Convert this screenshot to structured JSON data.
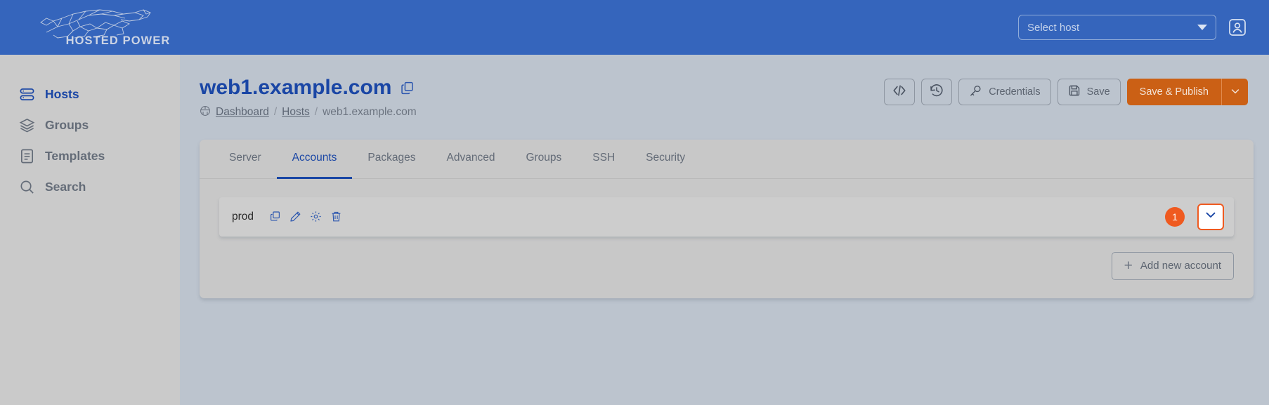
{
  "brand": {
    "wordmark": "HOSTED POWER",
    "logo_icon": "cheetah-wireframe-logo"
  },
  "topbar": {
    "host_select": {
      "placeholder": "Select host",
      "value": "Select host",
      "caret_icon": "caret-down-icon"
    },
    "user_icon": "user-account-icon",
    "background_color": "#3565bc"
  },
  "sidebar": {
    "items": [
      {
        "label": "Hosts",
        "icon": "server-stack-icon",
        "active": true
      },
      {
        "label": "Groups",
        "icon": "layers-icon",
        "active": false
      },
      {
        "label": "Templates",
        "icon": "document-list-icon",
        "active": false
      },
      {
        "label": "Search",
        "icon": "magnifier-icon",
        "active": false
      }
    ]
  },
  "page": {
    "title": "web1.example.com",
    "title_copy_icon": "copy-icon",
    "breadcrumb": {
      "home_icon": "globe-dashboard-icon",
      "items": [
        {
          "label": "Dashboard",
          "link": true
        },
        {
          "label": "Hosts",
          "link": true
        },
        {
          "label": "web1.example.com",
          "link": false
        }
      ],
      "separator": "/"
    }
  },
  "actions": {
    "code_button": {
      "label": "</>",
      "icon": "code-brackets-icon"
    },
    "history_button": {
      "label": "",
      "icon": "history-clock-icon"
    },
    "credentials_button": {
      "label": "Credentials",
      "icon": "key-icon"
    },
    "save_button": {
      "label": "Save",
      "icon": "floppy-disk-icon"
    },
    "publish_button": {
      "label": "Save & Publish",
      "caret_icon": "chevron-down-icon",
      "color": "#cb6015"
    }
  },
  "tabs": [
    {
      "label": "Server",
      "active": false
    },
    {
      "label": "Accounts",
      "active": true
    },
    {
      "label": "Packages",
      "active": false
    },
    {
      "label": "Advanced",
      "active": false
    },
    {
      "label": "Groups",
      "active": false
    },
    {
      "label": "SSH",
      "active": false
    },
    {
      "label": "Security",
      "active": false
    }
  ],
  "accounts": {
    "rows": [
      {
        "name": "prod",
        "icons": [
          "copy-icon",
          "edit-pencil-icon",
          "gear-icon",
          "trash-icon"
        ],
        "badge_count": "1",
        "badge_color": "#ef5a20",
        "expand_icon": "chevron-down-icon",
        "expand_highlight_color": "#ef5a20"
      }
    ],
    "add_button": {
      "label": "Add new account",
      "icon": "plus-icon"
    }
  }
}
